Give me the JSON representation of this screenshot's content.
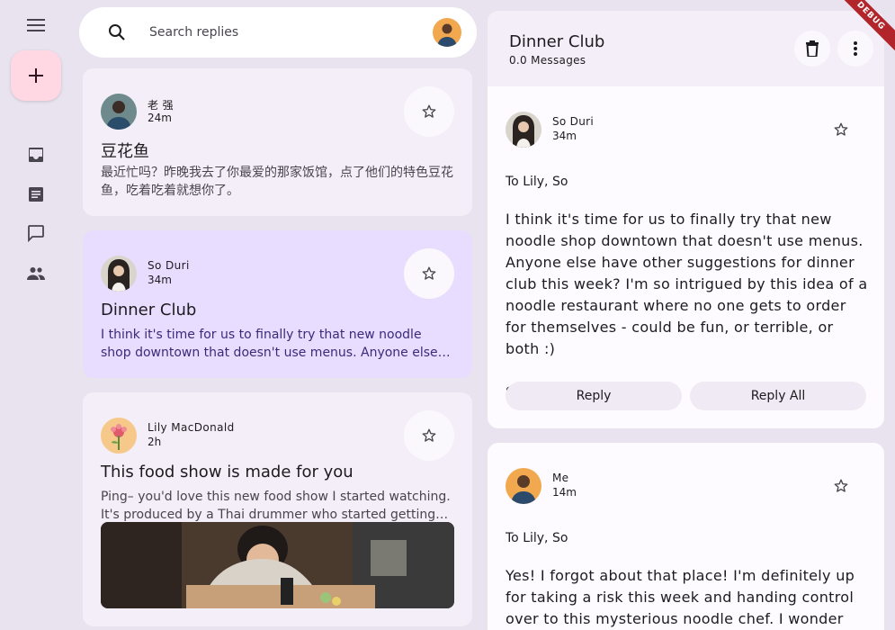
{
  "search": {
    "placeholder": "Search replies"
  },
  "nav": {
    "items": [
      {
        "icon": "inbox-icon"
      },
      {
        "icon": "article-icon"
      },
      {
        "icon": "chat-icon"
      },
      {
        "icon": "people-icon"
      }
    ]
  },
  "emails": [
    {
      "sender": "老 强",
      "time": "24m",
      "subject": "豆花鱼",
      "preview": "最近忙吗？昨晚我去了你最爱的那家饭馆，点了他们的特色豆花鱼，吃着吃着就想你了。"
    },
    {
      "sender": "So Duri",
      "time": "34m",
      "subject": "Dinner Club",
      "preview": "I think it's time for us to finally try that new noodle shop downtown that doesn't use menus. Anyone else have other suggestions for dinner club this week?"
    },
    {
      "sender": "Lily MacDonald",
      "time": "2h",
      "subject": "This food show is made for you",
      "preview": "Ping– you'd love this new food show I started watching. It's produced by a Thai drummer who started getting recognized for her cooking."
    }
  ],
  "detail": {
    "title": "Dinner Club",
    "count": "0.0 Messages",
    "messages": [
      {
        "sender": "So Duri",
        "time": "34m",
        "to": "To Lily, So",
        "body": "I think it's time for us to finally try that new noodle shop downtown that doesn't use menus. Anyone else have other suggestions for dinner club this week? I'm so intrigued by this idea of a noodle restaurant where no one gets to order for themselves - could be fun, or terrible, or both :)\n\nSo",
        "reply": "Reply",
        "reply_all": "Reply All"
      },
      {
        "sender": "Me",
        "time": "14m",
        "to": "To Lily, So",
        "body": "Yes! I forgot about that place! I'm definitely up for taking a risk this week and handing control over to this mysterious noodle chef. I wonder what happens"
      }
    ]
  },
  "debug_label": "DEBUG",
  "colors": {
    "background": "#e9e3f0",
    "card": "#f3eef7",
    "selected_card": "#e9ddff",
    "fab": "#ffd8e4",
    "debug": "#b2262b"
  }
}
